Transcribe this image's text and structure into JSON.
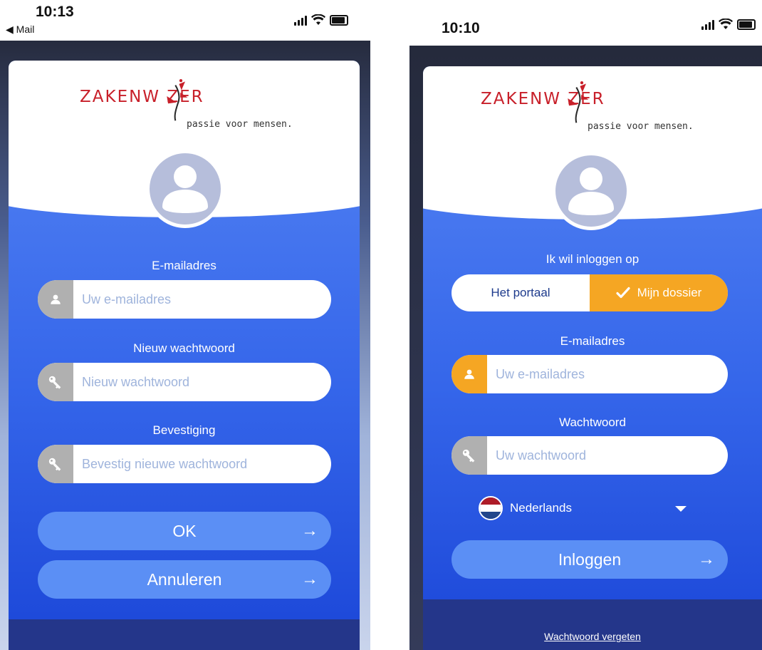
{
  "left": {
    "status": {
      "time": "10:13",
      "back_label": "◀ Mail"
    },
    "logo": {
      "wordmark": "ZAKENW ZER",
      "tagline": "passie voor mensen."
    },
    "email": {
      "label": "E-mailadres",
      "placeholder": "Uw e-mailadres"
    },
    "new_password": {
      "label": "Nieuw wachtwoord",
      "placeholder": "Nieuw wachtwoord"
    },
    "confirm": {
      "label": "Bevestiging",
      "placeholder": "Bevestig nieuwe wachtwoord"
    },
    "ok_button": "OK",
    "cancel_button": "Annuleren",
    "arrow": "→"
  },
  "right": {
    "status": {
      "time": "10:10"
    },
    "logo": {
      "wordmark": "ZAKENW ZER",
      "tagline": "passie voor mensen."
    },
    "login_to_label": "Ik wil inloggen op",
    "toggle": {
      "portal": "Het portaal",
      "dossier": "Mijn dossier",
      "selected": "dossier"
    },
    "email": {
      "label": "E-mailadres",
      "placeholder": "Uw e-mailadres"
    },
    "password": {
      "label": "Wachtwoord",
      "placeholder": "Uw wachtwoord"
    },
    "language": "Nederlands",
    "login_button": "Inloggen",
    "arrow": "→",
    "forgot_link": "Wachtwoord vergeten"
  },
  "colors": {
    "accent_orange": "#f5a623",
    "brand_red": "#c8202a",
    "button_blue": "#5b8ff5",
    "card_blue": "#3566ea",
    "footer_navy": "#24368a"
  }
}
